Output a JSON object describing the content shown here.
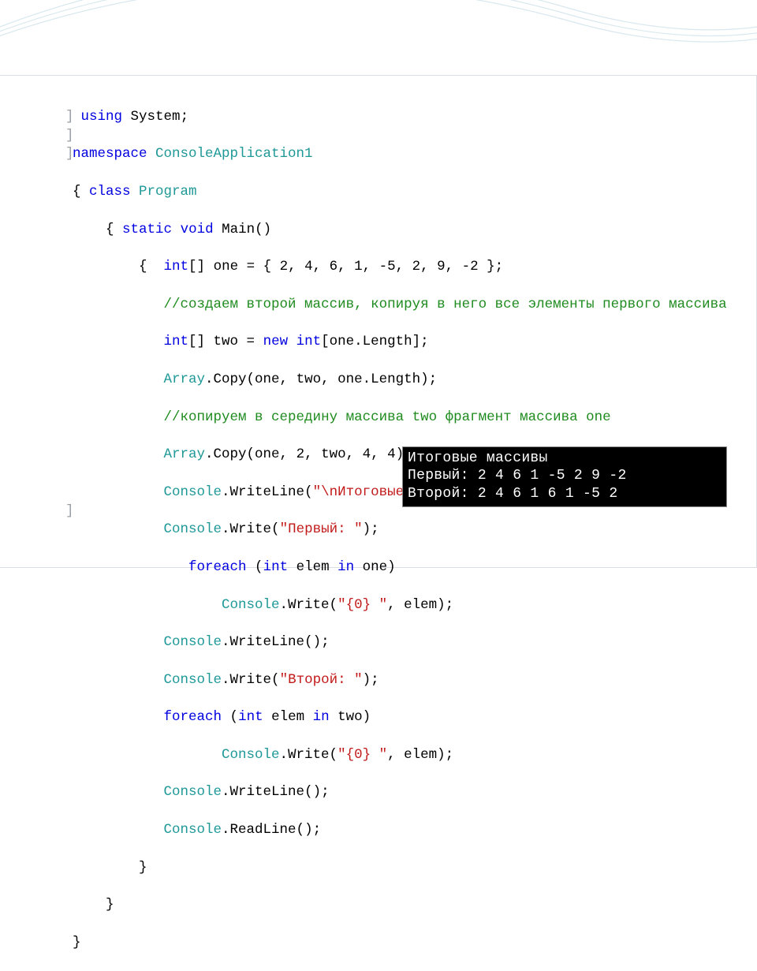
{
  "code": {
    "l1": {
      "kw1": "using",
      "sp1": " ",
      "id": "System",
      "end": ";"
    },
    "l2": {
      "kw1": "namespace",
      "sp1": " ",
      "cls": "ConsoleApplication1"
    },
    "l3": {
      "open": "{ ",
      "kw1": "class",
      "sp1": " ",
      "cls": "Program"
    },
    "l4": {
      "ind": "    ",
      "open": "{ ",
      "kw1": "static",
      "sp1": " ",
      "kw2": "void",
      "sp2": " ",
      "id": "Main",
      "paren": "()"
    },
    "l5": {
      "ind": "        ",
      "open": "{  ",
      "kw1": "int",
      "arr": "[]",
      "sp1": " one = { 2, 4, 6, 1, -5, 2, 9, -2 };"
    },
    "l6": {
      "ind": "           ",
      "com": "//создаем второй массив, копируя в него все элементы первого массива"
    },
    "l7": {
      "ind": "           ",
      "kw1": "int",
      "arr": "[] two = ",
      "kw2": "new",
      "sp": " ",
      "kw3": "int",
      "tail": "[one.Length];"
    },
    "l8": {
      "ind": "           ",
      "cls": "Array",
      "rest": ".Copy(one, two, one.Length);"
    },
    "l9": {
      "ind": "           ",
      "com": "//копируем в середину массива two фрагмент массива one"
    },
    "l10": {
      "ind": "           ",
      "cls": "Array",
      "rest": ".Copy(one, 2, two, 4, 4);"
    },
    "l11": {
      "ind": "           ",
      "cls": "Console",
      "dot": ".WriteLine(",
      "str": "\"\\nИтоговые массивы \"",
      "end": ");"
    },
    "l12": {
      "ind": "           ",
      "cls": "Console",
      "dot": ".Write(",
      "str": "\"Первый: \"",
      "end": ");"
    },
    "l13": {
      "ind": "              ",
      "kw1": "foreach",
      "sp": " (",
      "kw2": "int",
      "mid": " elem ",
      "kw3": "in",
      "tail": " one)"
    },
    "l14": {
      "ind": "                  ",
      "cls": "Console",
      "dot": ".Write(",
      "str": "\"{0} \"",
      "end": ", elem);"
    },
    "l15": {
      "ind": "           ",
      "cls": "Console",
      "rest": ".WriteLine();"
    },
    "l16": {
      "ind": "           ",
      "cls": "Console",
      "dot": ".Write(",
      "str": "\"Второй: \"",
      "end": ");"
    },
    "l17": {
      "ind": "           ",
      "kw1": "foreach",
      "sp": " (",
      "kw2": "int",
      "mid": " elem ",
      "kw3": "in",
      "tail": " two)"
    },
    "l18": {
      "ind": "                  ",
      "cls": "Console",
      "dot": ".Write(",
      "str": "\"{0} \"",
      "end": ", elem);"
    },
    "l19": {
      "ind": "           ",
      "cls": "Console",
      "rest": ".WriteLine();"
    },
    "l20": {
      "ind": "           ",
      "cls": "Console",
      "rest": ".ReadLine();"
    },
    "l21": {
      "ind": "        }",
      "txt": ""
    },
    "l22": {
      "ind": "    }",
      "txt": ""
    },
    "l23": {
      "ind": "}",
      "txt": ""
    }
  },
  "gutter": {
    "l2": "]",
    "l3": "]",
    "l4": "]",
    "l23": "]"
  },
  "console": {
    "lines": "Итоговые массивы\nПервый: 2 4 6 1 -5 2 9 -2\nВторой: 2 4 6 1 6 1 -5 2"
  }
}
